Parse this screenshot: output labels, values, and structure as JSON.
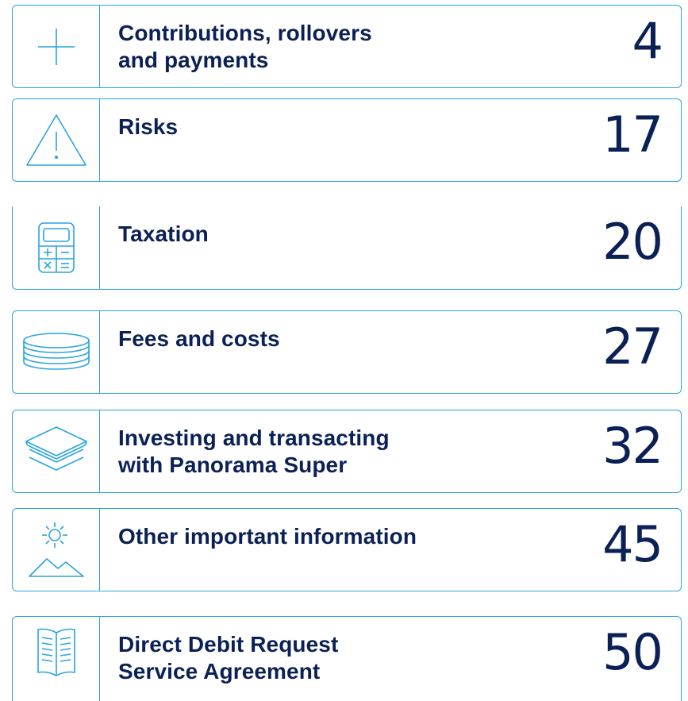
{
  "accent_color": "#2aa4dc",
  "text_color": "#0b2155",
  "toc": {
    "items": [
      {
        "title": "Contributions, rollovers\nand payments",
        "page": "4",
        "icon": "plus-icon"
      },
      {
        "title": "Risks",
        "page": "17",
        "icon": "warning-triangle-icon"
      },
      {
        "title": "Taxation",
        "page": "20",
        "icon": "calculator-icon"
      },
      {
        "title": "Fees and costs",
        "page": "27",
        "icon": "coin-stack-icon"
      },
      {
        "title": "Investing and transacting\nwith Panorama Super",
        "page": "32",
        "icon": "layers-icon"
      },
      {
        "title": "Other important information",
        "page": "45",
        "icon": "sun-mountain-icon"
      },
      {
        "title": "Direct Debit Request\nService Agreement",
        "page": "50",
        "icon": "open-book-icon"
      }
    ]
  }
}
